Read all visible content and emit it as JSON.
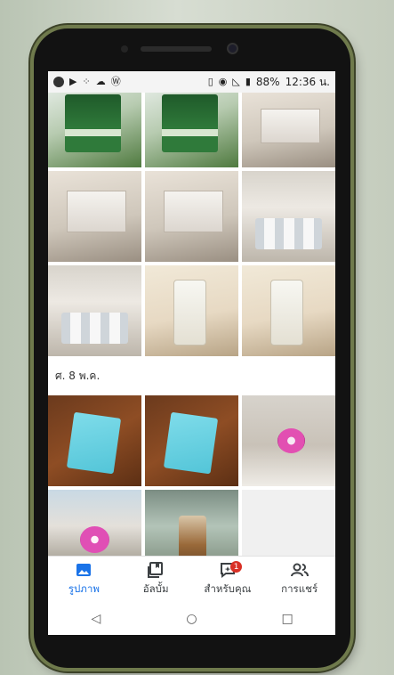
{
  "statusbar": {
    "battery": "88%",
    "time": "12:36 น."
  },
  "date_header": "ศ. 8 พ.ค.",
  "bottom_nav": [
    {
      "label": "รูปภาพ",
      "icon": "photos-icon",
      "active": true
    },
    {
      "label": "อัลบั้ม",
      "icon": "albums-icon",
      "active": false
    },
    {
      "label": "สำหรับคุณ",
      "icon": "for-you-icon",
      "active": false,
      "badge": "1"
    },
    {
      "label": "การแชร์",
      "icon": "sharing-icon",
      "active": false
    }
  ],
  "system_nav": [
    "back-icon",
    "home-icon",
    "recents-icon"
  ],
  "colors": {
    "accent": "#1a73e8",
    "badge": "#d93025"
  }
}
